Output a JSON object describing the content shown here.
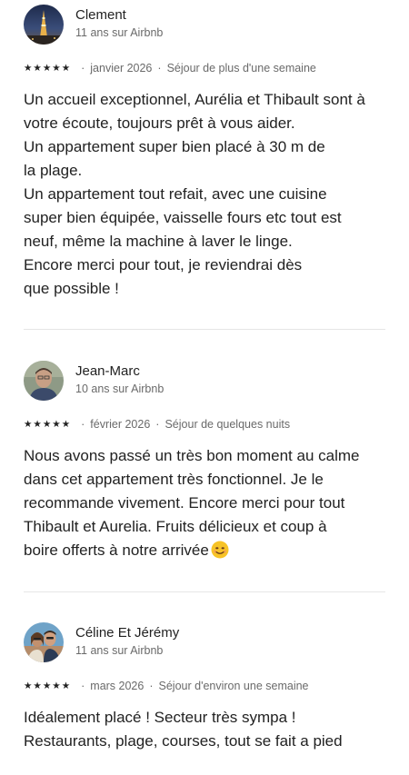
{
  "reviews": [
    {
      "name": "Clement",
      "tenure": "11 ans sur Airbnb",
      "rating": 5,
      "date": "janvier 2026",
      "stay": "Séjour de plus d'une semaine",
      "lines": [
        "Un accueil exceptionnel, Aurélia et Thibault sont à",
        "votre écoute, toujours prêt à vous aider.",
        "Un appartement super bien placé à 30 m de",
        "la plage.",
        "Un appartement tout refait, avec une cuisine",
        "super bien équipée, vaisselle fours etc  tout est",
        "neuf, même la machine à laver le linge.",
        "Encore merci pour tout, je reviendrai dès",
        "que possible !"
      ]
    },
    {
      "name": "Jean-Marc",
      "tenure": "10 ans sur Airbnb",
      "rating": 5,
      "date": "février 2026",
      "stay": "Séjour de quelques nuits",
      "lines": [
        "Nous avons passé un très bon moment au calme",
        "dans cet appartement très fonctionnel. Je le",
        "recommande vivement. Encore merci pour tout",
        "Thibault et Aurelia. Fruits délicieux et coup à",
        "boire offerts à notre arrivée"
      ],
      "trailing_emoji": "smiling-face-emoji"
    },
    {
      "name": "Céline Et Jérémy",
      "tenure": "11 ans sur Airbnb",
      "rating": 5,
      "date": "mars 2026",
      "stay": "Séjour d'environ une semaine",
      "lines": [
        "Idéalement placé ! Secteur très sympa !",
        "Restaurants, plage, courses, tout se fait a pied"
      ]
    }
  ],
  "separator": "·",
  "star_glyph": "★"
}
